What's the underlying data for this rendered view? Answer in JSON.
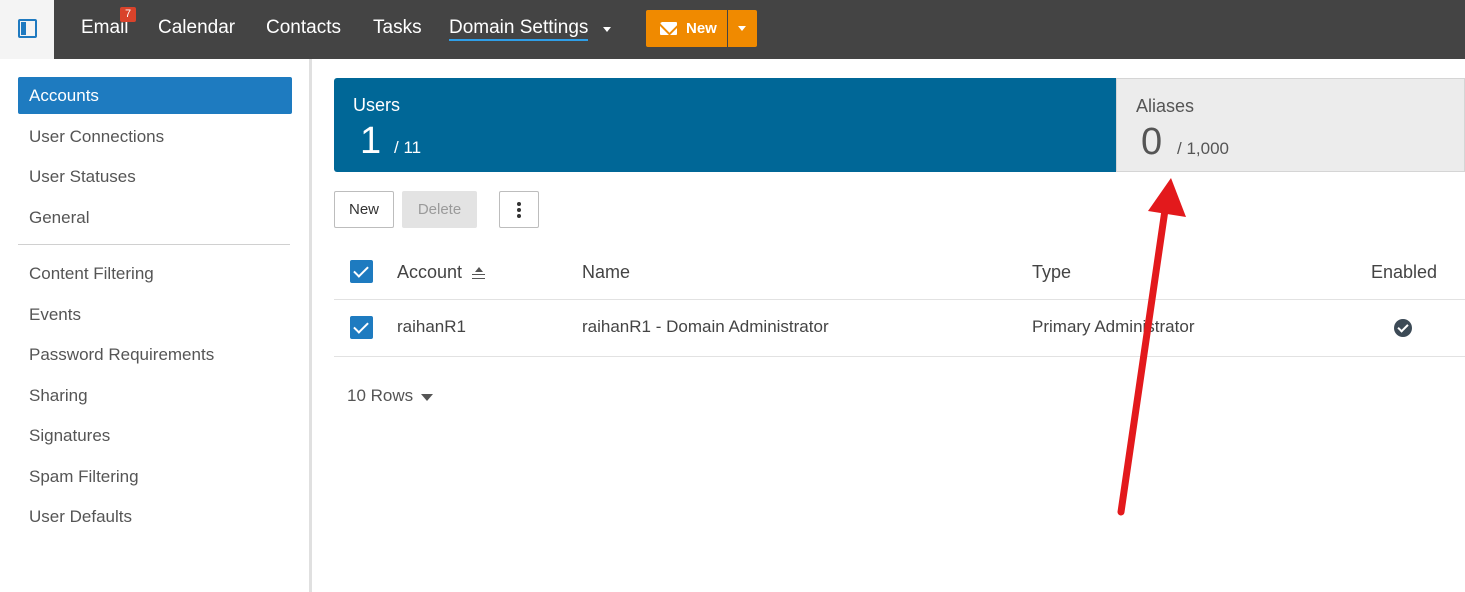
{
  "topnav": {
    "email_label": "Email",
    "email_badge": "7",
    "calendar_label": "Calendar",
    "contacts_label": "Contacts",
    "tasks_label": "Tasks",
    "domain_settings_label": "Domain Settings",
    "new_button_label": "New"
  },
  "sidebar": {
    "items": [
      {
        "label": "Accounts"
      },
      {
        "label": "User Connections"
      },
      {
        "label": "User Statuses"
      },
      {
        "label": "General"
      },
      {
        "label": "Content Filtering"
      },
      {
        "label": "Events"
      },
      {
        "label": "Password Requirements"
      },
      {
        "label": "Sharing"
      },
      {
        "label": "Signatures"
      },
      {
        "label": "Spam Filtering"
      },
      {
        "label": "User Defaults"
      }
    ]
  },
  "stats": {
    "users": {
      "label": "Users",
      "value": "1",
      "max": "/ 11"
    },
    "aliases": {
      "label": "Aliases",
      "value": "0",
      "max": "/ 1,000"
    }
  },
  "toolbar": {
    "new_label": "New",
    "delete_label": "Delete"
  },
  "table": {
    "headers": {
      "account": "Account",
      "name": "Name",
      "type": "Type",
      "enabled": "Enabled"
    },
    "rows": [
      {
        "account": "raihanR1",
        "name": "raihanR1 - Domain Administrator",
        "type": "Primary Administrator",
        "enabled": true
      }
    ]
  },
  "pager": {
    "rows_label": "10 Rows"
  },
  "colors": {
    "topbar": "#444444",
    "accent_blue": "#1e7bc0",
    "users_panel": "#006797",
    "new_button": "#f08a00",
    "annotation_arrow": "#e3191c"
  }
}
